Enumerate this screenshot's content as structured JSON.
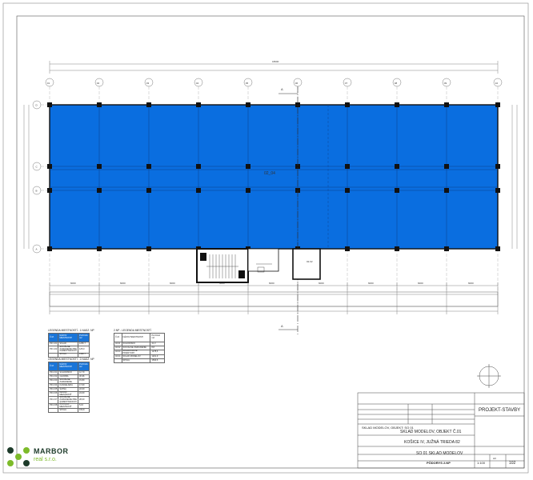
{
  "plan": {
    "room_label": "02_04",
    "stair_label": "02.02",
    "section_mark": "A",
    "total_dim": "18000",
    "bay_dim": "6000",
    "axes_x": [
      "01",
      "02",
      "03",
      "04",
      "05",
      "06",
      "07",
      "08",
      "09",
      "10"
    ],
    "axes_y": [
      "D",
      "C",
      "B",
      "A"
    ],
    "colors": {
      "floor": "#0a6ee0",
      "lines": "#333333",
      "columns": "#111111"
    }
  },
  "legend_left": {
    "title_a": "LEGENDA MIESTNOSTÍ - 1.NADZ. NP",
    "head_a": [
      "Č.M.",
      "NÁZOV MIESTNOSTI",
      "PLOCHA m2"
    ],
    "rows_a": [
      [
        "PR.1.01",
        "SKLAD",
        "1265,7"
      ],
      [
        "PR.1.02",
        "SOCIÁLNE ZARIADENIE PRE ZAMESTNANCOV",
        "125,0"
      ],
      [
        "",
        "SPOLU",
        "1390,7"
      ]
    ],
    "title_b": "LEGENDA MIESTNOSTÍ - 2.NADZ. NP",
    "head_b": [
      "Č.M.",
      "NÁZOV MIESTNOSTI",
      "PLOCHA m2"
    ],
    "rows_b": [
      [
        "PR.2.01",
        "SCHODISKO",
        "12,70"
      ],
      [
        "PR.2.02",
        "CHODBA",
        "30,96"
      ],
      [
        "PR.2.03",
        "SOCIÁLNE ZARIADENIE",
        "15,80"
      ],
      [
        "PR.2.04",
        "KANCELÁRIA",
        "17,60"
      ],
      [
        "PR.2.05",
        "ŠATŇA",
        "22,00"
      ],
      [
        "PR.2.06",
        "DENNÁ MIESTNOSŤ",
        "24,60"
      ],
      [
        "PR.2.07",
        "SOCIÁLNE ZARIADENIE PRE ZAMESTNANCOV",
        "28,00"
      ],
      [
        "PR.2.08",
        "ČISTIACA MIESTNOSŤ",
        "5,10"
      ],
      [
        "",
        "SPOLU",
        "156,8"
      ]
    ]
  },
  "legend_right": {
    "title": "2.NP - LEGENDA MIESTNOSTÍ",
    "head": [
      "Č.M.",
      "NÁZOV MIESTNOSTI",
      "PLOCHA m2"
    ],
    "rows": [
      [
        "02.01",
        "SCHODISKO",
        "41,3"
      ],
      [
        "02.02",
        "SOCIÁLNE ZARIADENIE",
        "8,8"
      ],
      [
        "02.03",
        "SKLADOVACIE PRIESTORY",
        "1278,6"
      ],
      [
        "02.04",
        "SKLAD MODELOV",
        "1201,9"
      ],
      [
        "",
        "SPOLU",
        "1530,6"
      ]
    ]
  },
  "title_block": {
    "firm": "PROJEKT-STAVBY",
    "project_label": "SKLAD MODELOV, OBJEKT: SO 01",
    "project": "SKLAD MODELOV, OBJEKT Č.01",
    "location": "KOŠICE IV, JUŽNÁ TRIEDA 82",
    "drawing": "SO 01 SKLAD MODELOV",
    "drawing_name": "PÔDORYS 2.NP",
    "scale": "1:100",
    "sheet_no": "102",
    "format": "A3"
  },
  "logo": {
    "name_top": "MARBOR",
    "name_bottom": "real s.r.o.",
    "colors": {
      "dot_dark": "#1d3b2a",
      "dot_green": "#7dbb2a"
    }
  }
}
